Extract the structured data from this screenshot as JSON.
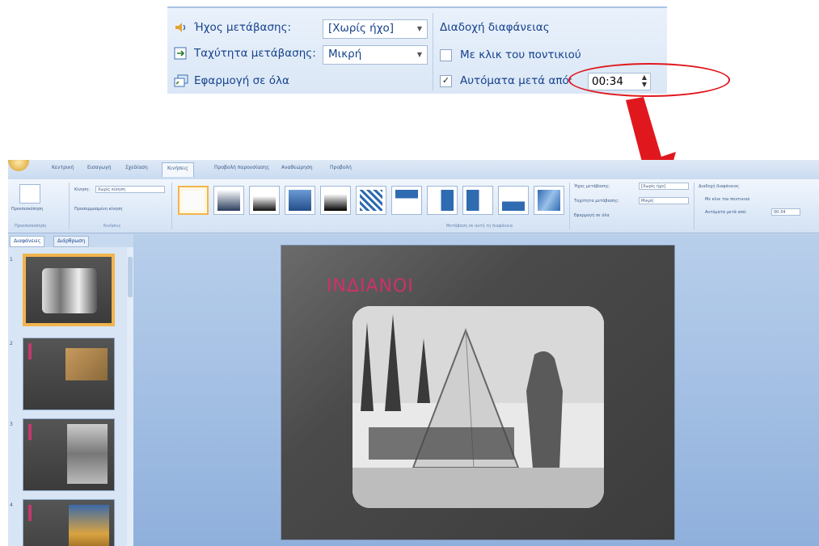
{
  "zoom": {
    "sound_label": "Ήχος μετάβασης:",
    "sound_value": "[Χωρίς ήχο]",
    "speed_label": "Ταχύτητα μετάβασης:",
    "speed_value": "Μικρή",
    "apply_all": "Εφαρμογή σε όλα",
    "advance_title": "Διαδοχή διαφάνειας",
    "on_click": "Με κλικ του ποντικιού",
    "auto_after": "Αυτόματα μετά από:",
    "auto_time": "00:34",
    "check_mark": "✓"
  },
  "app": {
    "tabs": [
      "Κεντρική",
      "Εισαγωγή",
      "Σχεδίαση",
      "Κινήσεις",
      "Προβολή παρουσίασης",
      "Αναθεώρηση",
      "Προβολή"
    ],
    "active_tab": "Κινήσεις",
    "preview_label": "Προεπισκόπηση",
    "custom_anim": "Προσαρμοσμένη κίνηση",
    "animate_label": "Κίνηση:",
    "animate_value": "Χωρίς κίνηση",
    "group_preview": "Προεπισκόπηση",
    "group_animations": "Κινήσεις",
    "group_transition": "Μετάβαση σε αυτή τη διαφάνεια",
    "small_sound": "Ήχος μετάβασης:",
    "small_sound_value": "[Χωρίς ήχο]",
    "small_speed": "Ταχύτητα μετάβασης:",
    "small_speed_value": "Μικρή",
    "small_apply": "Εφαρμογή σε όλα",
    "small_advance": "Διαδοχή διαφάνειας",
    "small_click": "Με κλικ του ποντικιού",
    "small_auto": "Αυτόματα μετά από:",
    "small_time": "00:34",
    "pane_tab1": "Διαφάνειες",
    "pane_tab2": "Διάρθρωση",
    "slide_numbers": [
      "1",
      "2",
      "3",
      "4"
    ],
    "slide_title": "ΙΝΔΙΑΝΟΙ"
  },
  "colors": {
    "accent_red": "#e0181e",
    "title_pink": "#d0306a",
    "ribbon_text": "#15428b"
  }
}
